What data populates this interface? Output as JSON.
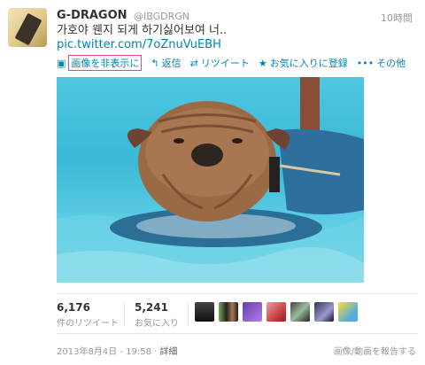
{
  "tweet": {
    "display_name": "G-DRAGON",
    "handle": "@IBGDRGN",
    "time_ago": "10時間",
    "text": "가호야 웬지 되게 하기싫어보여 너..",
    "link": "pic.twitter.com/7oZnuVuEBH"
  },
  "actions": {
    "hide_image": "画像を非表示に",
    "reply": "返信",
    "retweet": "リツイート",
    "favorite": "お気に入りに登録",
    "more": "その他"
  },
  "stats": {
    "retweets_count": "6,176",
    "retweets_label": "件のリツイート",
    "favorites_count": "5,241",
    "favorites_label": "お気に入り"
  },
  "footer": {
    "date": "2013年8月4日 - 19:58",
    "separator": "·",
    "details": "詳細",
    "report": "画像/動画を報告する"
  },
  "colors": {
    "link": "#0084b4",
    "muted": "#999999",
    "water": "#3ab8d6"
  },
  "icons": [
    "reply-icon",
    "retweet-icon",
    "star-icon",
    "more-icon",
    "image-icon"
  ]
}
